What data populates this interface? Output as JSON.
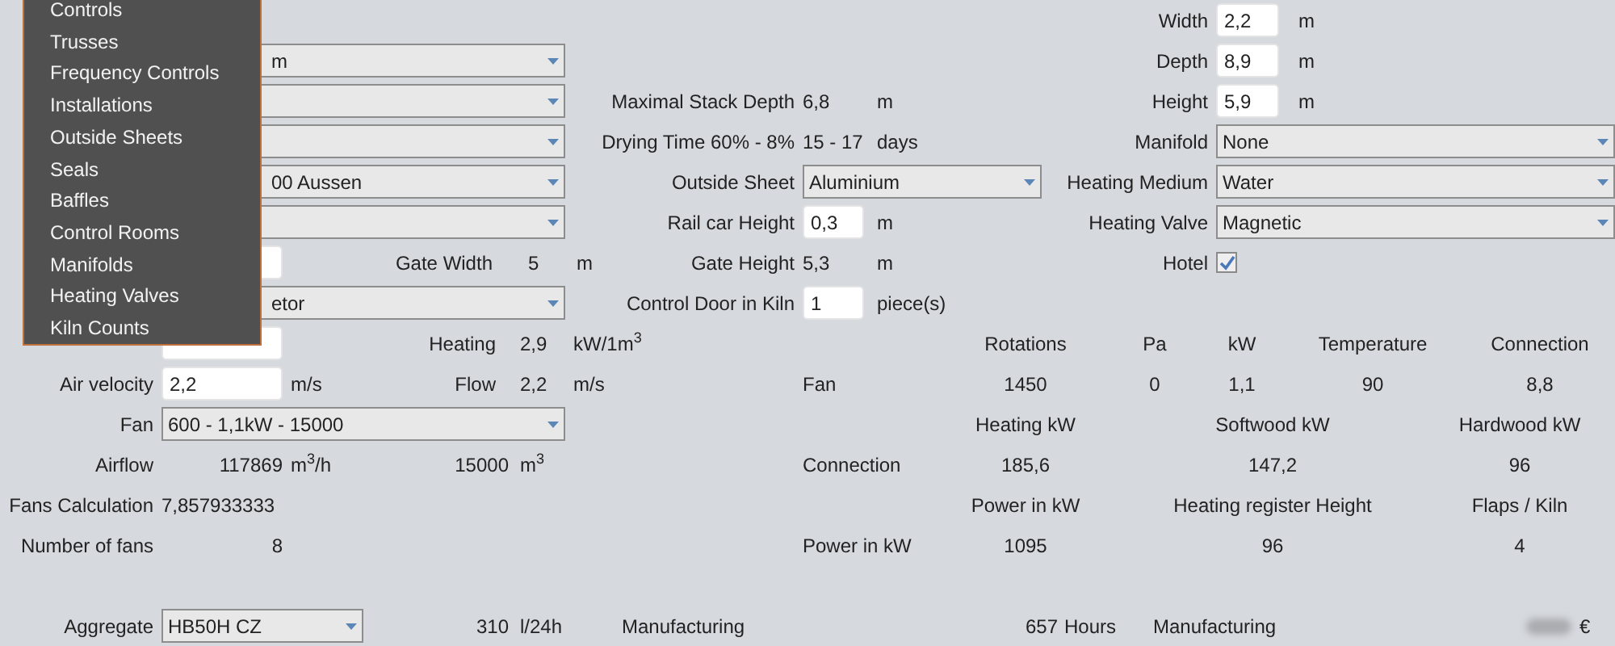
{
  "menu": {
    "items": [
      "Controls",
      "Trusses",
      "Frequency Controls",
      "Installations",
      "Outside Sheets",
      "Seals",
      "Baffles",
      "Control Rooms",
      "Manifolds",
      "Heating Valves",
      "Kiln Counts"
    ]
  },
  "width": {
    "label": "Width",
    "value": "2,2",
    "unit": "m"
  },
  "depth": {
    "label": "Depth",
    "value": "8,9",
    "unit": "m"
  },
  "height": {
    "label": "Height",
    "value": "5,9",
    "unit": "m"
  },
  "left_fields": [
    {
      "kind": "select",
      "value": "m"
    },
    {
      "kind": "select"
    },
    {
      "kind": "select"
    },
    {
      "kind": "select",
      "value": "00 Aussen"
    },
    {
      "kind": "select"
    },
    {
      "kind": "input"
    },
    {
      "kind": "select",
      "value": "etor"
    }
  ],
  "maximal_stack_depth": {
    "label": "Maximal Stack Depth",
    "value": "6,8",
    "unit": "m"
  },
  "drying_time": {
    "label": "Drying Time 60% - 8%",
    "value": "15 - 17",
    "unit": "days"
  },
  "manifold": {
    "label": "Manifold",
    "value": "None"
  },
  "outside_sheet": {
    "label": "Outside Sheet",
    "value": "Aluminium"
  },
  "heating_medium": {
    "label": "Heating Medium",
    "value": "Water"
  },
  "rail_car_height": {
    "label": "Rail car Height",
    "value": "0,3",
    "unit": "m"
  },
  "heating_valve": {
    "label": "Heating Valve",
    "value": "Magnetic"
  },
  "gate_width": {
    "label": "Gate Width",
    "value": "5",
    "unit": "m"
  },
  "gate_height": {
    "label": "Gate Height",
    "value": "5,3",
    "unit": "m"
  },
  "hotel": {
    "label": "Hotel",
    "checked": true
  },
  "control_door": {
    "label": "Control Door in Kiln",
    "value": "1",
    "unit": "piece(s)"
  },
  "heating": {
    "label": "Heating",
    "value": "2,9",
    "unit": "kW/1m$^{3}$"
  },
  "air_velocity": {
    "label": "Air velocity",
    "value": "2,2",
    "unit": "m/s"
  },
  "flow": {
    "label": "Flow",
    "value": "2,2",
    "unit": "m/s"
  },
  "fan": {
    "label": "Fan",
    "value": "600 - 1,1kW - 15000"
  },
  "airflow": {
    "label": "Airflow",
    "value": "117869",
    "unit": "m$^{3}$/h",
    "volume": "15000",
    "volume_unit": "m$^{3}$"
  },
  "fans_calculation": {
    "label": "Fans Calculation",
    "value": "7,857933333"
  },
  "number_of_fans": {
    "label": "Number of fans",
    "value": "8"
  },
  "fan_table": {
    "columns": [
      "Rotations",
      "Pa",
      "kW",
      "Temperature",
      "Connection"
    ],
    "rows": [
      {
        "label": "Fan",
        "cells": [
          "1450",
          "0",
          "1,1",
          "90",
          "8,8"
        ]
      }
    ]
  },
  "heating_table": {
    "columns": [
      "Heating kW",
      "Softwood kW",
      "Hardwood kW"
    ],
    "rows": [
      {
        "label": "Connection",
        "cells": [
          "185,6",
          "147,2",
          "96"
        ]
      }
    ]
  },
  "power_table": {
    "columns": [
      "Power in kW",
      "Heating register Height",
      "Flaps / Kiln"
    ],
    "rows": [
      {
        "label": "Power in kW",
        "cells": [
          "1095",
          "96",
          "4"
        ]
      }
    ]
  },
  "aggregate": {
    "label": "Aggregate",
    "value": "HB50H CZ",
    "capacity": "310",
    "capacity_unit": "l/24h",
    "process": "Manufacturing"
  },
  "manufacturing_time": {
    "value": "657",
    "unit": "Hours"
  },
  "price": {
    "label": "Manufacturing",
    "currency": "€"
  }
}
